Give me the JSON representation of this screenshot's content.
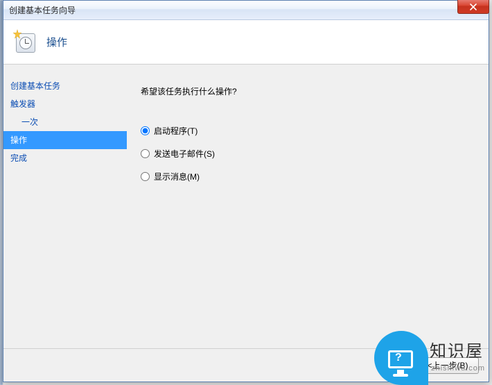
{
  "window": {
    "title": "创建基本任务向导"
  },
  "header": {
    "title": "操作"
  },
  "sidebar": {
    "items": [
      {
        "label": "创建基本任务",
        "type": "link"
      },
      {
        "label": "触发器",
        "type": "link"
      },
      {
        "label": "一次",
        "type": "sub"
      },
      {
        "label": "操作",
        "type": "selected"
      },
      {
        "label": "完成",
        "type": "link"
      }
    ]
  },
  "main": {
    "question": "希望该任务执行什么操作?",
    "options": [
      {
        "label": "启动程序(T)",
        "value": "start",
        "checked": true
      },
      {
        "label": "发送电子邮件(S)",
        "value": "email",
        "checked": false
      },
      {
        "label": "显示消息(M)",
        "value": "message",
        "checked": false
      }
    ]
  },
  "footer": {
    "back": "<上一步(B)"
  },
  "watermark": {
    "text": "知识屋",
    "url": "zhishiwu.com"
  }
}
